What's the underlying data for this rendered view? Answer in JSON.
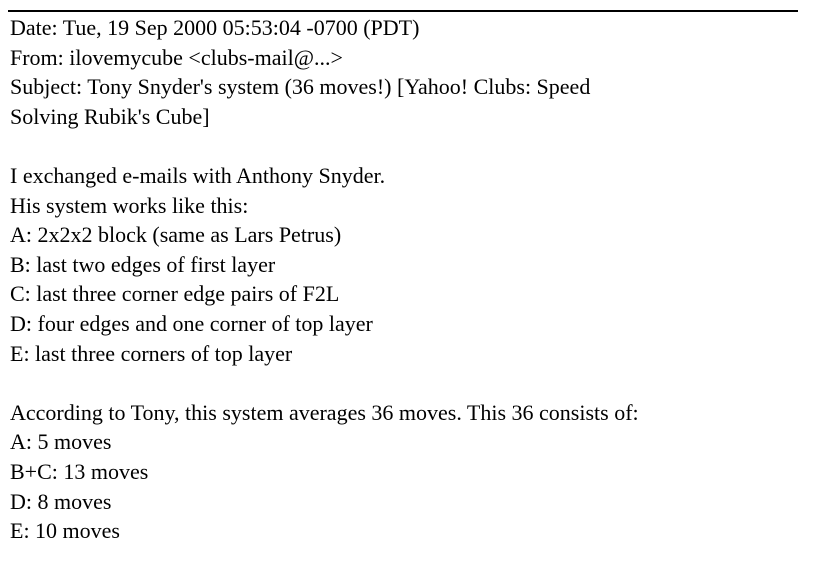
{
  "header": {
    "date": "Date: Tue, 19 Sep 2000 05:53:04 -0700 (PDT)",
    "from": "From: ilovemycube <clubs-mail@...>",
    "subject_line1": "Subject: Tony Snyder's system (36 moves!) [Yahoo! Clubs: Speed",
    "subject_line2": "Solving Rubik's Cube]"
  },
  "body": {
    "intro": [
      "I exchanged e-mails with Anthony Snyder.",
      "His system works like this:"
    ],
    "steps": [
      "A: 2x2x2 block (same as Lars Petrus)",
      "B: last two edges of first layer",
      "C: last three corner edge pairs of F2L",
      "D: four edges and one corner of top layer",
      "E: last three corners of top layer"
    ],
    "summary": "According to Tony, this system averages 36 moves. This 36 consists of:",
    "counts": [
      "A: 5 moves",
      "B+C: 13 moves",
      "D: 8 moves",
      "E: 10 moves"
    ]
  }
}
